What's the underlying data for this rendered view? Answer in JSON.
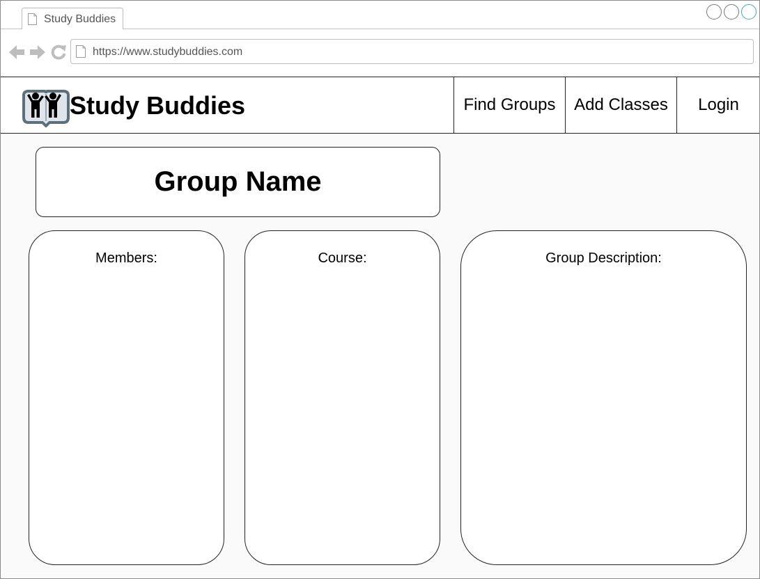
{
  "browser": {
    "tab_title": "Study Buddies",
    "url": "https://www.studybuddies.com",
    "icons": [
      "page-icon",
      "back-arrow-icon",
      "forward-arrow-icon",
      "reload-icon",
      "minimize-circle-icon",
      "maximize-circle-icon",
      "close-circle-icon"
    ]
  },
  "header": {
    "brand": "Study Buddies",
    "logo_icon": "study-buddies-logo-icon",
    "nav": {
      "find_groups": "Find Groups",
      "add_classes": "Add Classes",
      "login": "Login"
    }
  },
  "main": {
    "group_name": "Group Name",
    "members_label": "Members:",
    "course_label": "Course:",
    "description_label": "Group Description:"
  },
  "colors": {
    "active_window_control": "#3aa6e0",
    "logo_frame": "#5b6f7c",
    "border": "#222222"
  }
}
